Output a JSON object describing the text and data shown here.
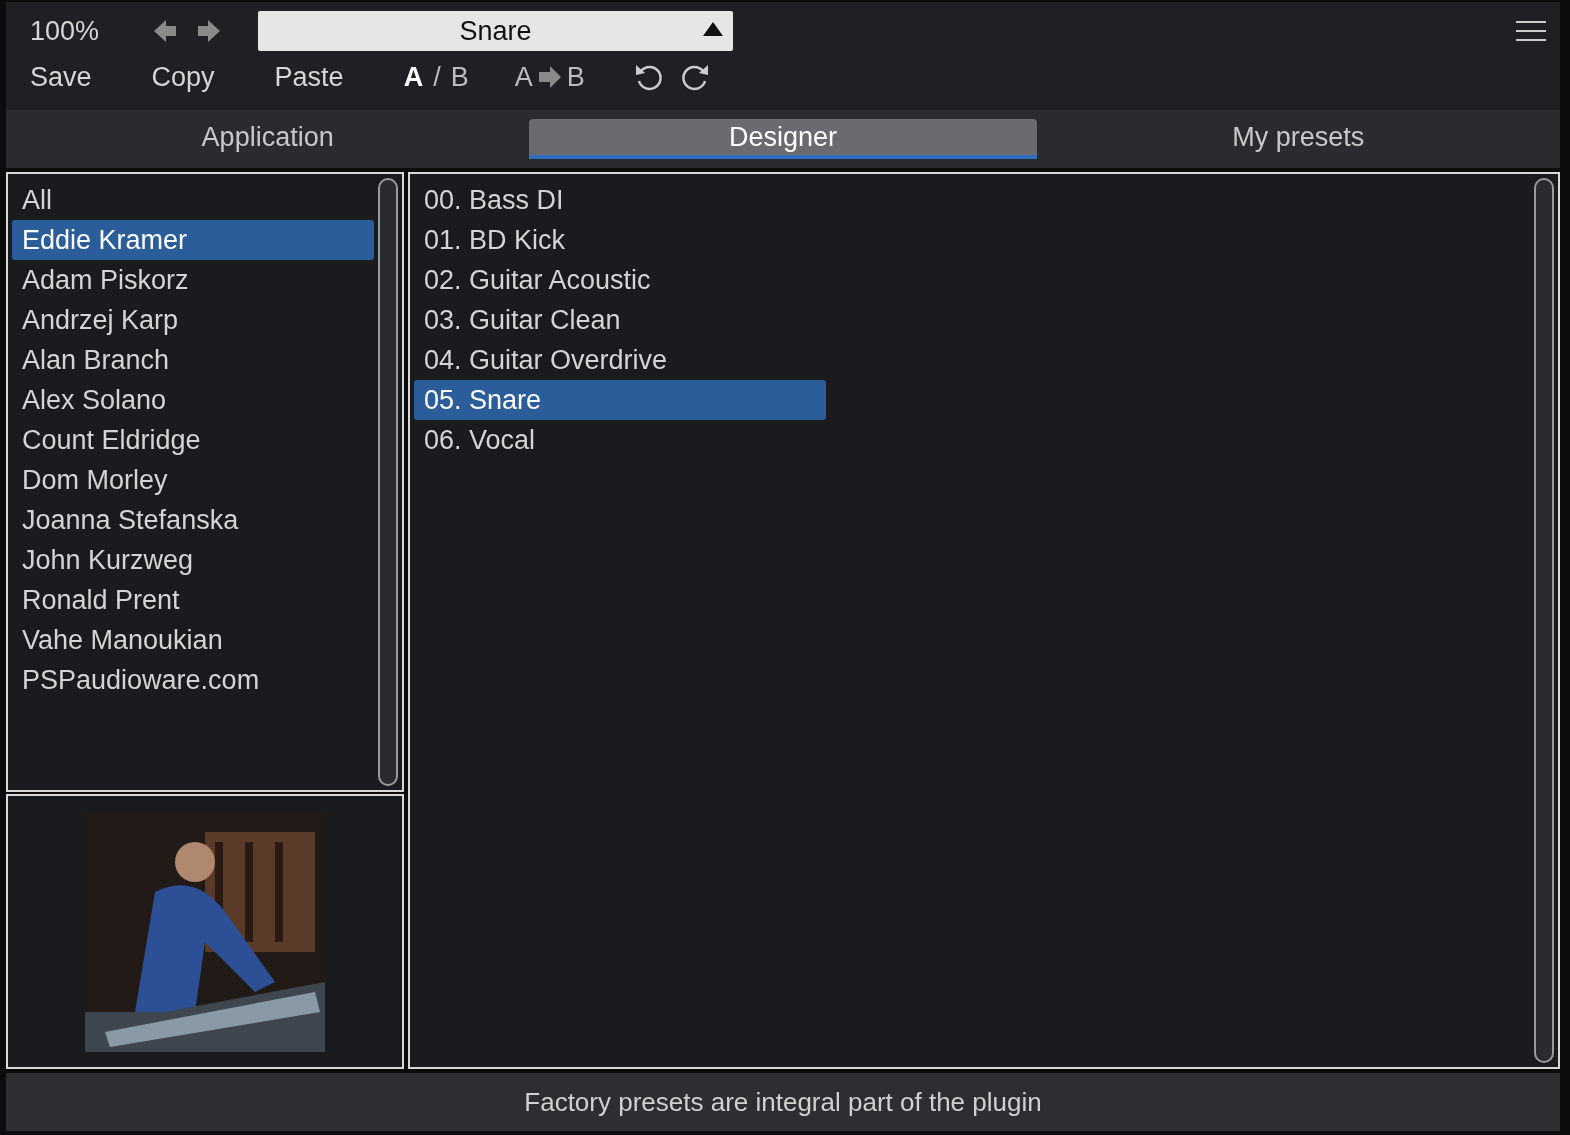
{
  "toolbar": {
    "zoom": "100%",
    "preset": "Snare",
    "actions": [
      "Save",
      "Copy",
      "Paste"
    ],
    "ab": {
      "items": [
        {
          "label": "A",
          "selected": true
        },
        {
          "label": "B",
          "selected": false
        }
      ],
      "separator": "/"
    },
    "copy_ab": {
      "from": "A",
      "to": "B"
    }
  },
  "tabs": [
    {
      "label": "Application",
      "selected": false
    },
    {
      "label": "Designer",
      "selected": true
    },
    {
      "label": "My presets",
      "selected": false
    }
  ],
  "designers": [
    {
      "label": "All",
      "selected": false
    },
    {
      "label": "Eddie Kramer",
      "selected": true
    },
    {
      "label": "Adam Piskorz",
      "selected": false
    },
    {
      "label": "Andrzej Karp",
      "selected": false
    },
    {
      "label": "Alan Branch",
      "selected": false
    },
    {
      "label": "Alex Solano",
      "selected": false
    },
    {
      "label": "Count Eldridge",
      "selected": false
    },
    {
      "label": "Dom Morley",
      "selected": false
    },
    {
      "label": "Joanna Stefanska",
      "selected": false
    },
    {
      "label": "John Kurzweg",
      "selected": false
    },
    {
      "label": "Ronald Prent",
      "selected": false
    },
    {
      "label": "Vahe Manoukian",
      "selected": false
    },
    {
      "label": "PSPaudioware.com",
      "selected": false
    }
  ],
  "presets": [
    {
      "label": "00. Bass DI",
      "selected": false
    },
    {
      "label": "01. BD Kick",
      "selected": false
    },
    {
      "label": "02. Guitar Acoustic",
      "selected": false
    },
    {
      "label": "03. Guitar Clean",
      "selected": false
    },
    {
      "label": "04. Guitar Overdrive",
      "selected": false
    },
    {
      "label": "05. Snare",
      "selected": true
    },
    {
      "label": "06. Vocal",
      "selected": false
    }
  ],
  "status_bar": "Factory presets are integral part of the plugin"
}
